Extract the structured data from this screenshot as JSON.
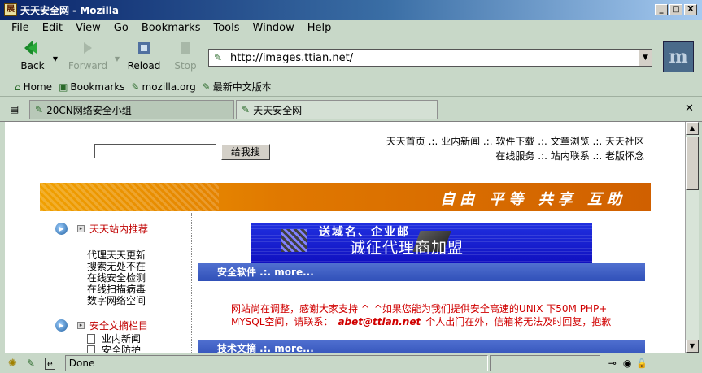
{
  "window": {
    "title": "天天安全网 - Mozilla",
    "app_icon": "Mozilla-app-icon",
    "minimize": "_",
    "maximize": "□",
    "close": "X"
  },
  "menu": [
    "File",
    "Edit",
    "View",
    "Go",
    "Bookmarks",
    "Tools",
    "Window",
    "Help"
  ],
  "toolbar": {
    "back": "Back",
    "forward": "Forward",
    "reload": "Reload",
    "stop": "Stop",
    "url": "http://images.ttian.net/"
  },
  "personal_bar": [
    "Home",
    "Bookmarks",
    "mozilla.org",
    "最新中文版本"
  ],
  "tabs": [
    {
      "label": "20CN网络安全小组",
      "active": false
    },
    {
      "label": "天天安全网",
      "active": true
    }
  ],
  "page": {
    "search_button": "给我搜",
    "search_value": "",
    "topnav_line1": "天天首页 .:. 业内新闻 .:. 软件下载 .:. 文章浏览 .:. 天天社区",
    "topnav_line2": "在线服务 .:. 站内联系 .:. 老版怀念",
    "banner_slogan": "自由 平等 共享 互助",
    "sidebar": {
      "head1": "天天站内推荐",
      "list1": [
        "代理天天更新",
        "搜索无处不在",
        "在线安全检测",
        "在线扫描病毒",
        "数字网络空间"
      ],
      "head2": "安全文摘栏目",
      "list2": [
        "业内新闻",
        "安全防护"
      ]
    },
    "ad": {
      "line1": "送域名、企业邮",
      "line2": "诚征代理商加盟"
    },
    "section1": "安全软件 .:. more...",
    "notice_part1": "网站尚在调整，感谢大家支持 ^_^如果您能为我们提供安全高速的UNIX 下50M PHP+",
    "notice_part2": "MYSQL空间，请联系：",
    "notice_email": "abet@ttian.net",
    "notice_part3": "个人出门在外，信箱将无法及时回复，抱歉",
    "section2": "技术文摘 .:. more..."
  },
  "status": {
    "text": "Done"
  },
  "colors": {
    "chrome": "#c8d8c8",
    "banner": "#e07800",
    "section_bar": "#3050b8",
    "accent_red": "#d00000"
  }
}
